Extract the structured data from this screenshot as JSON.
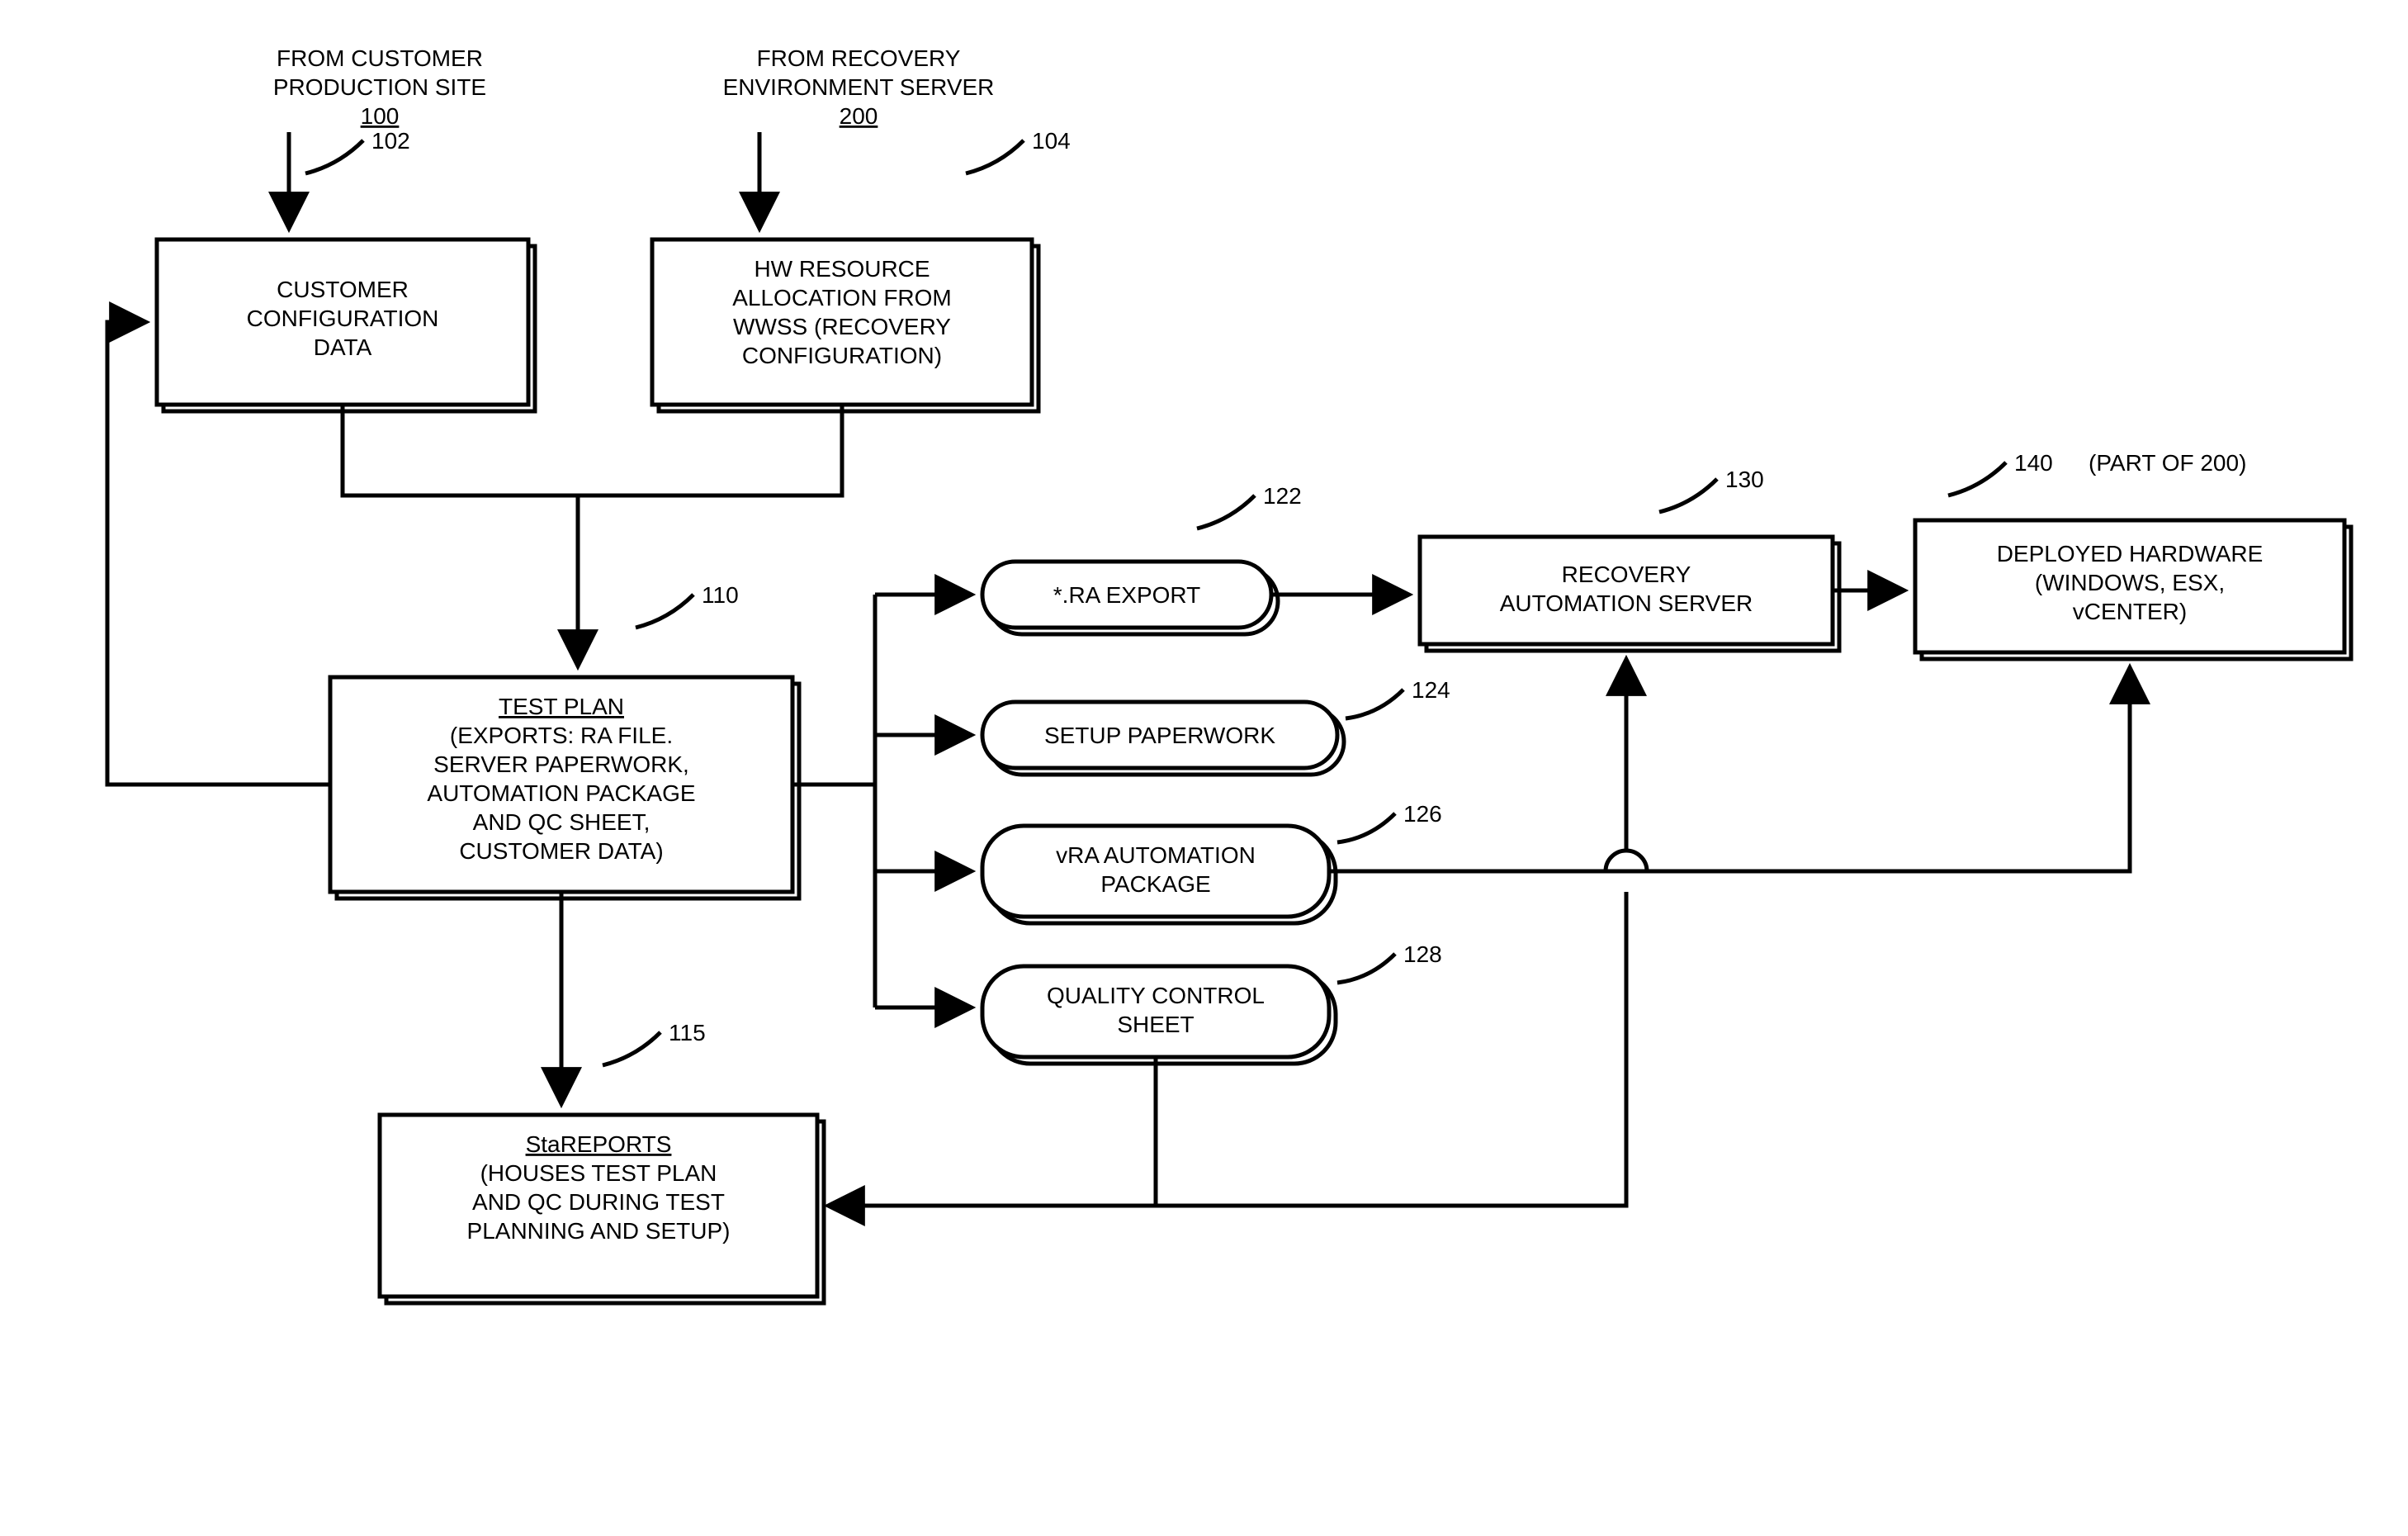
{
  "header1": {
    "line1": "FROM CUSTOMER",
    "line2": "PRODUCTION SITE",
    "num": "100"
  },
  "header2": {
    "line1": "FROM RECOVERY",
    "line2": "ENVIRONMENT SERVER",
    "num": "200"
  },
  "box102": {
    "num": "102",
    "l1": "CUSTOMER",
    "l2": "CONFIGURATION",
    "l3": "DATA"
  },
  "box104": {
    "num": "104",
    "l1": "HW RESOURCE",
    "l2": "ALLOCATION FROM",
    "l3": "WWSS (RECOVERY",
    "l4": "CONFIGURATION)"
  },
  "box110": {
    "num": "110",
    "title": "TEST PLAN",
    "l1": "(EXPORTS: RA FILE.",
    "l2": "SERVER PAPERWORK,",
    "l3": "AUTOMATION PACKAGE",
    "l4": "AND QC SHEET,",
    "l5": "CUSTOMER DATA)"
  },
  "box115": {
    "num": "115",
    "title": "StaREPORTS",
    "l1": "(HOUSES TEST PLAN",
    "l2": "AND QC DURING TEST",
    "l3": "PLANNING AND SETUP)"
  },
  "pill122": {
    "num": "122",
    "text": "*.RA EXPORT"
  },
  "pill124": {
    "num": "124",
    "text": "SETUP PAPERWORK"
  },
  "pill126": {
    "num": "126",
    "l1": "vRA AUTOMATION",
    "l2": "PACKAGE"
  },
  "pill128": {
    "num": "128",
    "l1": "QUALITY CONTROL",
    "l2": "SHEET"
  },
  "box130": {
    "num": "130",
    "l1": "RECOVERY",
    "l2": "AUTOMATION SERVER"
  },
  "box140": {
    "num": "140",
    "note": "(PART OF 200)",
    "l1": "DEPLOYED HARDWARE",
    "l2": "(WINDOWS, ESX,",
    "l3": "vCENTER)"
  }
}
